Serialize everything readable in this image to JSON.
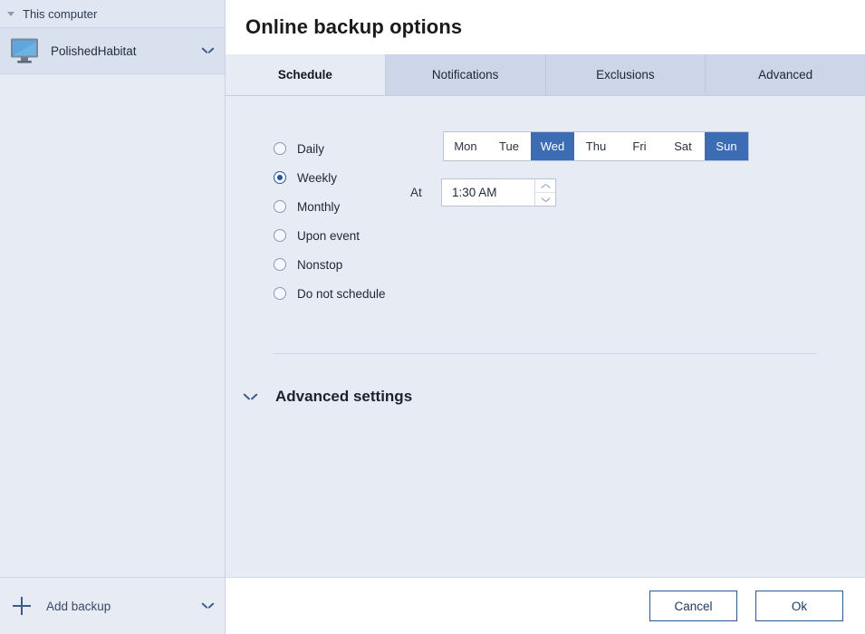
{
  "sidebar": {
    "header_label": "This computer",
    "header_toggle_icon": "triangle-down-icon",
    "computer": {
      "name": "PolishedHabitat",
      "icon": "monitor-icon",
      "expand_icon": "chevron-down-icon"
    },
    "footer": {
      "add_label": "Add backup",
      "add_icon": "plus-icon",
      "expand_icon": "chevron-down-icon"
    }
  },
  "header": {
    "title": "Online backup options"
  },
  "tabs": [
    {
      "label": "Schedule",
      "active": true
    },
    {
      "label": "Notifications",
      "active": false
    },
    {
      "label": "Exclusions",
      "active": false
    },
    {
      "label": "Advanced",
      "active": false
    }
  ],
  "schedule": {
    "options": [
      {
        "label": "Daily",
        "selected": false
      },
      {
        "label": "Weekly",
        "selected": true
      },
      {
        "label": "Monthly",
        "selected": false
      },
      {
        "label": "Upon event",
        "selected": false
      },
      {
        "label": "Nonstop",
        "selected": false
      },
      {
        "label": "Do not schedule",
        "selected": false
      }
    ],
    "days": [
      {
        "label": "Mon",
        "selected": false
      },
      {
        "label": "Tue",
        "selected": false
      },
      {
        "label": "Wed",
        "selected": true
      },
      {
        "label": "Thu",
        "selected": false
      },
      {
        "label": "Fri",
        "selected": false
      },
      {
        "label": "Sat",
        "selected": false
      },
      {
        "label": "Sun",
        "selected": true
      }
    ],
    "at_label": "At",
    "time_value": "1:30 AM",
    "spinner_up_icon": "chevron-up-icon",
    "spinner_down_icon": "chevron-down-icon"
  },
  "advanced_settings": {
    "label": "Advanced settings",
    "toggle_icon": "chevron-down-icon"
  },
  "footer": {
    "cancel_label": "Cancel",
    "ok_label": "Ok"
  },
  "colors": {
    "accent_blue": "#3b6cb4",
    "panel_bg": "#e7ebf4",
    "tab_inactive_bg": "#ccd6e8",
    "button_border": "#2f5596"
  }
}
